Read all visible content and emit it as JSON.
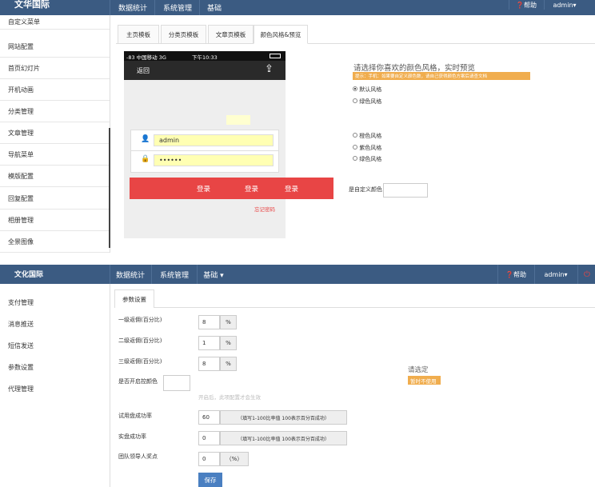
{
  "top": {
    "brand": "文华国际",
    "nav": [
      "数据统计",
      "系统管理",
      "基础"
    ],
    "help": "帮助",
    "user": "admin",
    "sidebar": [
      "自定义菜单",
      "网站配置",
      "首页幻灯片",
      "开机动画",
      "分类管理",
      "文章管理",
      "导航菜单",
      "模版配置",
      "回复配置",
      "相册管理",
      "全景图像"
    ],
    "tabs": [
      "主页模板",
      "分类页模板",
      "文章页模板",
      "颜色风格&预览"
    ],
    "phone": {
      "status_left": "-83 中国移动 3G",
      "status_time": "下午10:33",
      "back": "返回",
      "username": "admin",
      "password": "••••••",
      "login_labels": [
        "登录",
        "登录",
        "登录"
      ],
      "forgot": "忘记密码"
    },
    "style_panel": {
      "heading": "请选择你喜欢的颜色风格，实时预览",
      "tip": "提示：手机：如果要自定义颜色数，请自己获得颜色方案后请查文档",
      "options": [
        "默认风格",
        "绿色风格",
        "橙色风格",
        "紫色风格",
        "绿色风格"
      ],
      "custom_label": "是自定义颜色"
    }
  },
  "bottom": {
    "brand": "文化国际",
    "nav": [
      "数据统计",
      "系统管理",
      "基础 ▾"
    ],
    "help": "帮助",
    "user": "admin",
    "sidebar": [
      "支付管理",
      "消息推送",
      "短信发送",
      "参数设置",
      "代理管理"
    ],
    "tab": "参数设置",
    "rows": [
      {
        "label": "一级返佣(百分比)",
        "value": "8",
        "addon": "%"
      },
      {
        "label": "二级返佣(百分比)",
        "value": "1",
        "addon": "%"
      },
      {
        "label": "三级返佣(百分比)",
        "value": "8",
        "addon": "%"
      }
    ],
    "color_label": "是否开启控颜色",
    "faint_hint": "开启后，此项配置才会生效",
    "right_prompt": "请选定",
    "right_badge": "暂时不使用",
    "rows2": [
      {
        "label": "试用盘成功率",
        "value": "60",
        "addon": "（填写1-100比率值 100表示百分百成功）"
      },
      {
        "label": "实盘成功率",
        "value": "0",
        "addon": "（填写1-100比率值 100表示百分百成功）"
      },
      {
        "label": "团队领导人奖点",
        "value": "0",
        "addon": "（%）"
      }
    ],
    "save": "保存"
  },
  "colors": {
    "topbar": "#3b5b82",
    "login_red": "#e84545",
    "orange": "#f0ad4e",
    "save_blue": "#4a7fc1"
  }
}
